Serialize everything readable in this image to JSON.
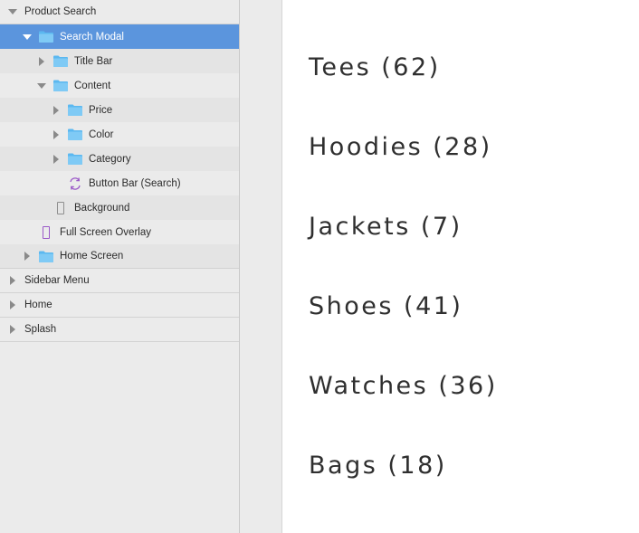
{
  "layers": [
    {
      "label": "Product Search",
      "indent": 0,
      "disclosure": "down",
      "icon": "none",
      "selected": false,
      "alt": false,
      "line": true
    },
    {
      "label": "Search Modal",
      "indent": 1,
      "disclosure": "down",
      "icon": "folder-icon",
      "selected": true,
      "alt": false,
      "line": false
    },
    {
      "label": "Title Bar",
      "indent": 2,
      "disclosure": "right",
      "icon": "folder-icon",
      "selected": false,
      "alt": true,
      "line": false
    },
    {
      "label": "Content",
      "indent": 2,
      "disclosure": "down",
      "icon": "folder-icon",
      "selected": false,
      "alt": false,
      "line": false
    },
    {
      "label": "Price",
      "indent": 3,
      "disclosure": "right",
      "icon": "folder-icon",
      "selected": false,
      "alt": true,
      "line": false
    },
    {
      "label": "Color",
      "indent": 3,
      "disclosure": "right",
      "icon": "folder-icon",
      "selected": false,
      "alt": false,
      "line": false
    },
    {
      "label": "Category",
      "indent": 3,
      "disclosure": "right",
      "icon": "folder-icon",
      "selected": false,
      "alt": true,
      "line": false
    },
    {
      "label": "Button Bar (Search)",
      "indent": 3,
      "disclosure": "none",
      "icon": "symbol-icon",
      "selected": false,
      "alt": false,
      "line": false
    },
    {
      "label": "Background",
      "indent": 2,
      "disclosure": "none",
      "icon": "rectangle-icon",
      "selected": false,
      "alt": true,
      "line": false
    },
    {
      "label": "Full Screen Overlay",
      "indent": 1,
      "disclosure": "none",
      "icon": "purple-rectangle-icon",
      "selected": false,
      "alt": false,
      "line": false
    },
    {
      "label": "Home Screen",
      "indent": 1,
      "disclosure": "right",
      "icon": "folder-icon",
      "selected": false,
      "alt": true,
      "line": true
    },
    {
      "label": "Sidebar Menu",
      "indent": 0,
      "disclosure": "right",
      "icon": "none",
      "selected": false,
      "alt": false,
      "line": true
    },
    {
      "label": "Home",
      "indent": 0,
      "disclosure": "right",
      "icon": "none",
      "selected": false,
      "alt": false,
      "line": true
    },
    {
      "label": "Splash",
      "indent": 0,
      "disclosure": "right",
      "icon": "none",
      "selected": false,
      "alt": false,
      "line": true
    }
  ],
  "canvas": {
    "categories": [
      "Tees (62)",
      "Hoodies (28)",
      "Jackets (7)",
      "Shoes (41)",
      "Watches (36)",
      "Bags (18)"
    ]
  },
  "colors": {
    "selection": "#5b95dd",
    "folder": "#5bb8f0",
    "symbol": "#9b59c8"
  }
}
